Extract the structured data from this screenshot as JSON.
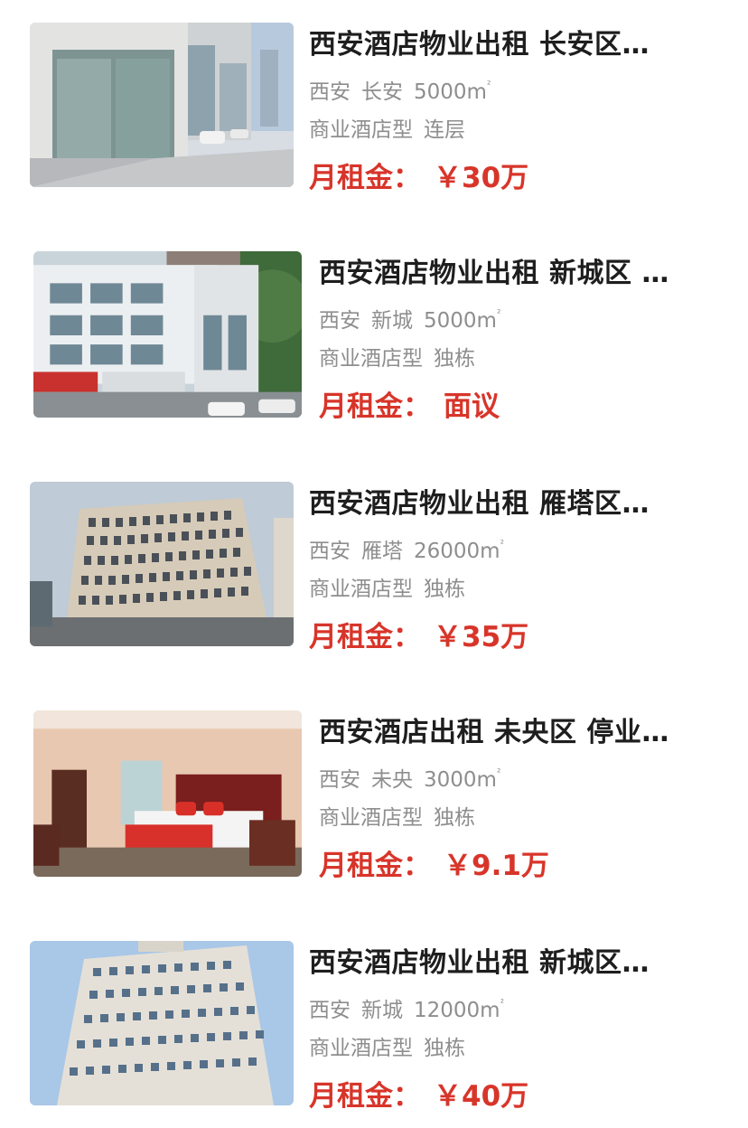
{
  "listings": [
    {
      "title": "西安酒店物业出租 长安区…",
      "city": "西安",
      "district": "长安",
      "area": "5000m",
      "area_sup": "²",
      "type": "商业酒店型",
      "structure": "连层",
      "rent_label": "月租金：",
      "rent_value": "￥30万",
      "photo": "glass-storefront-photo"
    },
    {
      "title": "西安酒店物业出租 新城区 …",
      "city": "西安",
      "district": "新城",
      "area": "5000m",
      "area_sup": "²",
      "type": "商业酒店型",
      "structure": "独栋",
      "rent_label": "月租金：",
      "rent_value": "面议",
      "photo": "white-building-photo"
    },
    {
      "title": "西安酒店物业出租 雁塔区…",
      "city": "西安",
      "district": "雁塔",
      "area": "26000m",
      "area_sup": "²",
      "type": "商业酒店型",
      "structure": "独栋",
      "rent_label": "月租金：",
      "rent_value": "￥35万",
      "photo": "tower-building-photo"
    },
    {
      "title": "西安酒店出租 未央区 停业…",
      "city": "西安",
      "district": "未央",
      "area": "3000m",
      "area_sup": "²",
      "type": "商业酒店型",
      "structure": "独栋",
      "rent_label": "月租金：",
      "rent_value": "￥9.1万",
      "photo": "hotel-room-photo"
    },
    {
      "title": "西安酒店物业出租 新城区…",
      "city": "西安",
      "district": "新城",
      "area": "12000m",
      "area_sup": "²",
      "type": "商业酒店型",
      "structure": "独栋",
      "rent_label": "月租金：",
      "rent_value": "￥40万",
      "photo": "highrise-building-photo"
    }
  ],
  "colors": {
    "rent": "#d8352a",
    "title": "#1e1e1e",
    "meta": "#8e8e8e"
  }
}
